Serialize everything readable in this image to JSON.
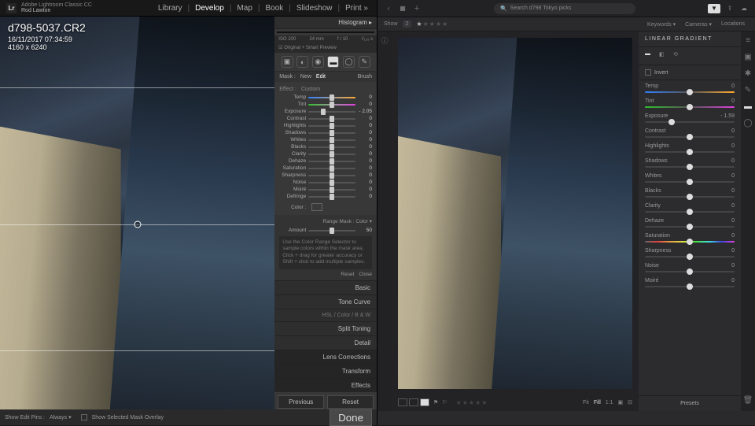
{
  "lrc": {
    "app_title": "Adobe Lightroom Classic CC",
    "user": "Rod Lawton",
    "logo": "Lr",
    "modules": [
      "Library",
      "Develop",
      "Map",
      "Book",
      "Slideshow",
      "Print »"
    ],
    "active_module": "Develop",
    "filename": "d798-5037.CR2",
    "datetime": "16/11/2017 07:34:59",
    "dimensions": "4160 x 6240",
    "histogram": {
      "label": "Histogram ▸",
      "iso": "ISO 200",
      "focal": "24 mm",
      "aperture": "f / 10",
      "shutter": "¹⁄₁₂₅ s",
      "preview": "☑ Original + Smart Preview"
    },
    "mask": {
      "label": "Mask :",
      "new": "New",
      "edit": "Edit",
      "brush": "Brush"
    },
    "effect": {
      "label": "Effect :",
      "preset": "Custom"
    },
    "sliders": [
      {
        "name": "Temp",
        "pos": 50,
        "val": "0",
        "track": "temp"
      },
      {
        "name": "Tint",
        "pos": 50,
        "val": "0",
        "track": "tint"
      },
      {
        "name": "Exposure",
        "pos": 32,
        "val": "- 2.05",
        "track": ""
      },
      {
        "name": "Contrast",
        "pos": 50,
        "val": "0",
        "track": ""
      },
      {
        "name": "Highlights",
        "pos": 50,
        "val": "0",
        "track": ""
      },
      {
        "name": "Shadows",
        "pos": 50,
        "val": "0",
        "track": ""
      },
      {
        "name": "Whites",
        "pos": 50,
        "val": "0",
        "track": ""
      },
      {
        "name": "Blacks",
        "pos": 50,
        "val": "0",
        "track": ""
      },
      {
        "name": "Clarity",
        "pos": 50,
        "val": "0",
        "track": ""
      },
      {
        "name": "Dehaze",
        "pos": 50,
        "val": "0",
        "track": ""
      },
      {
        "name": "Saturation",
        "pos": 50,
        "val": "0",
        "track": ""
      },
      {
        "name": "Sharpness",
        "pos": 50,
        "val": "0",
        "track": ""
      },
      {
        "name": "Noise",
        "pos": 50,
        "val": "0",
        "track": ""
      },
      {
        "name": "Moiré",
        "pos": 50,
        "val": "0",
        "track": ""
      },
      {
        "name": "Defringe",
        "pos": 50,
        "val": "0",
        "track": ""
      }
    ],
    "color_label": "Color :",
    "range_mask": {
      "label": "Range Mask :",
      "type": "Color ▾",
      "amount_label": "Amount",
      "amount_val": "50",
      "hint": "Use the Color Range Selector to sample colors within the mask area. Click + drag for greater accuracy or Shift + click to add multiple samples.",
      "reset": "Reset",
      "close": "Close"
    },
    "sections": [
      "Basic",
      "Tone Curve",
      "HSL  /  Color  /  B & W",
      "Split Toning",
      "Detail",
      "Lens Corrections",
      "Transform",
      "Effects"
    ],
    "prev_btn": "Previous",
    "reset_btn": "Reset",
    "done_btn": "Done",
    "foot_pins": "Show Edit Pins :",
    "foot_always": "Always ▾",
    "foot_overlay": "Show Selected Mask Overlay"
  },
  "cc": {
    "search_placeholder": "Search d798 Tokyo picks",
    "show_label": "Show",
    "show_count": "2",
    "filters": [
      "Keywords ▾",
      "Cameras ▾",
      "Locations"
    ],
    "panel_title": "LINEAR GRADIENT",
    "invert": "Invert",
    "sliders": [
      {
        "name": "Temp",
        "pos": 50,
        "val": "0",
        "track": "temp"
      },
      {
        "name": "Tint",
        "pos": 50,
        "val": "0",
        "track": "tint"
      },
      {
        "name": "Exposure",
        "pos": 30,
        "val": "- 1.59",
        "track": ""
      },
      {
        "name": "Contrast",
        "pos": 50,
        "val": "0",
        "track": ""
      },
      {
        "name": "Highlights",
        "pos": 50,
        "val": "0",
        "track": ""
      },
      {
        "name": "Shadows",
        "pos": 50,
        "val": "0",
        "track": ""
      },
      {
        "name": "Whites",
        "pos": 50,
        "val": "0",
        "track": ""
      },
      {
        "name": "Blacks",
        "pos": 50,
        "val": "0",
        "track": ""
      },
      {
        "name": "Clarity",
        "pos": 50,
        "val": "0",
        "track": ""
      },
      {
        "name": "Dehaze",
        "pos": 50,
        "val": "0",
        "track": ""
      },
      {
        "name": "Saturation",
        "pos": 50,
        "val": "0",
        "track": "sat"
      },
      {
        "name": "Sharpness",
        "pos": 50,
        "val": "0",
        "track": ""
      },
      {
        "name": "Noise",
        "pos": 50,
        "val": "0",
        "track": ""
      },
      {
        "name": "Moiré",
        "pos": 50,
        "val": "0",
        "track": ""
      }
    ],
    "presets": "Presets",
    "fit": "Fit",
    "fill": "Fill",
    "one": "1:1"
  }
}
